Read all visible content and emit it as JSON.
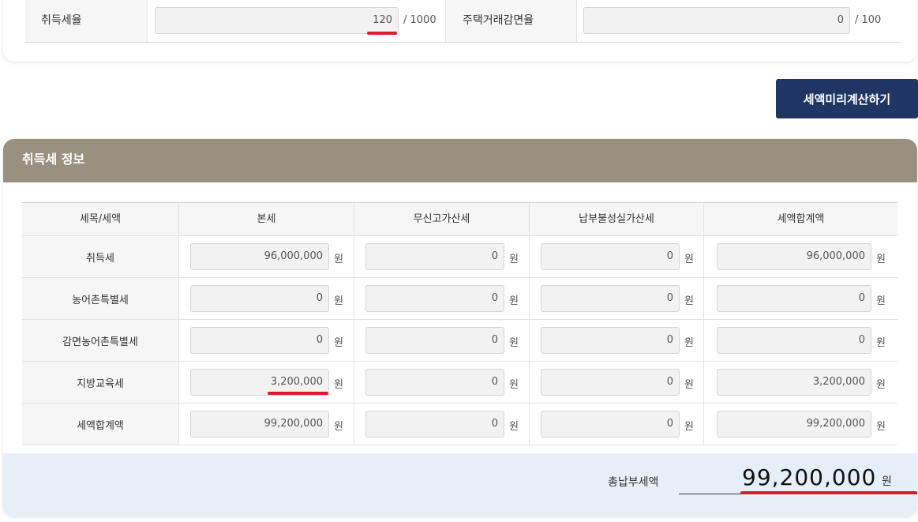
{
  "acquisition_settings": {
    "tax_rate_label": "취득세율",
    "tax_rate_value": "120",
    "tax_rate_unit": "/ 1000",
    "reduction_label": "주택거래감면율",
    "reduction_value": "0",
    "reduction_unit": "/ 100"
  },
  "calc_button_label": "세액미리계산하기",
  "tax_info": {
    "title": "취득세 정보",
    "headers": [
      "세목/세액",
      "본세",
      "무신고가산세",
      "납부불성실가산세",
      "세액합계액"
    ],
    "unit": "원",
    "rows": [
      {
        "label": "취득세",
        "values": [
          "96,000,000",
          "0",
          "0",
          "96,000,000"
        ]
      },
      {
        "label": "농어촌특별세",
        "values": [
          "0",
          "0",
          "0",
          "0"
        ]
      },
      {
        "label": "감면농어촌특별세",
        "values": [
          "0",
          "0",
          "0",
          "0"
        ]
      },
      {
        "label": "지방교육세",
        "values": [
          "3,200,000",
          "0",
          "0",
          "3,200,000"
        ]
      },
      {
        "label": "세액합계액",
        "values": [
          "99,200,000",
          "0",
          "0",
          "99,200,000"
        ]
      }
    ]
  },
  "total": {
    "label": "총납부세액",
    "value": "99,200,000",
    "unit": "원"
  },
  "accent_colors": {
    "button": "#1f3564",
    "panel_header": "#9a9080",
    "highlight": "#e0192f",
    "total_bg": "#e6eff7"
  }
}
